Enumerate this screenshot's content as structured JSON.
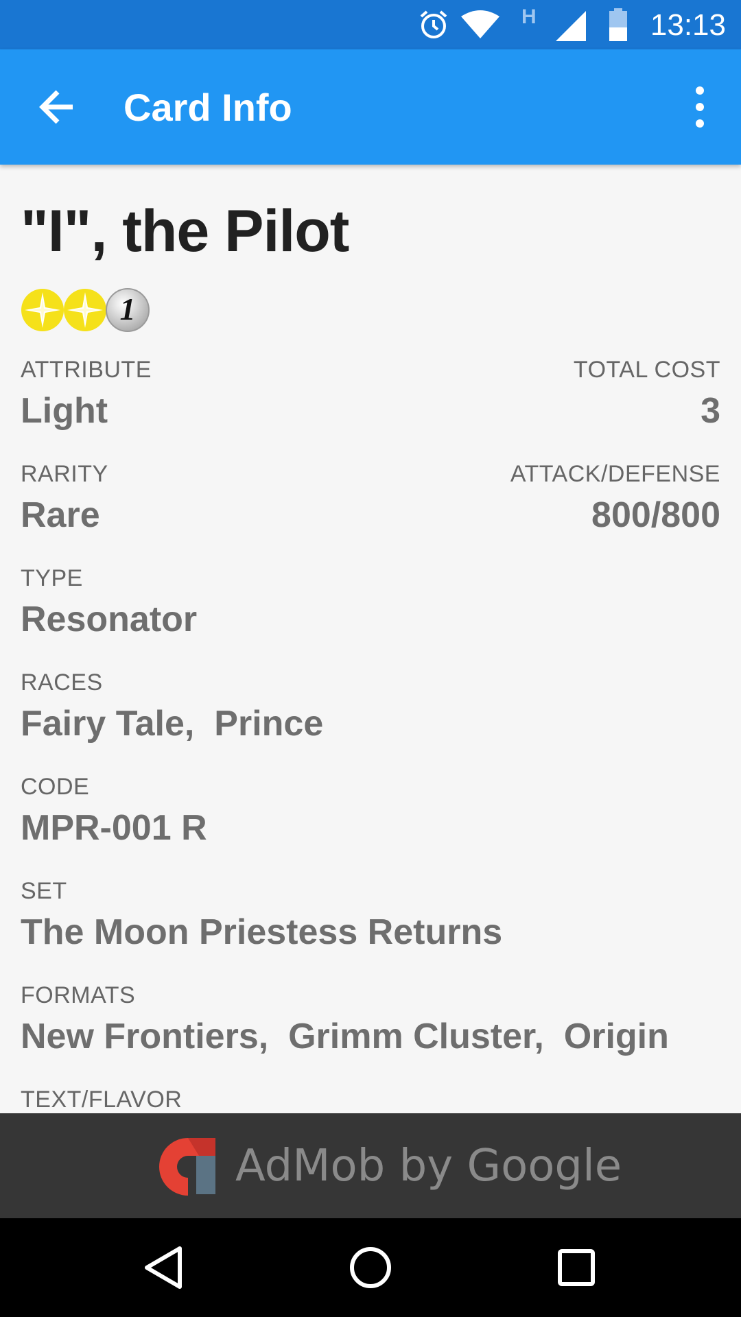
{
  "status": {
    "time": "13:13",
    "network_label": "H"
  },
  "appbar": {
    "title": "Card Info"
  },
  "card": {
    "name": "\"I\", the Pilot",
    "cost_number": "1",
    "attribute": {
      "label": "ATTRIBUTE",
      "value": "Light"
    },
    "total_cost": {
      "label": "TOTAL COST",
      "value": "3"
    },
    "rarity": {
      "label": "RARITY",
      "value": "Rare"
    },
    "attack_defense": {
      "label": "ATTACK/DEFENSE",
      "value": "800/800"
    },
    "type": {
      "label": "TYPE",
      "value": "Resonator"
    },
    "races": {
      "label": "RACES",
      "value": "Fairy Tale,  Prince"
    },
    "code": {
      "label": "CODE",
      "value": "MPR-001 R"
    },
    "set": {
      "label": "SET",
      "value": "The Moon Priestess Returns"
    },
    "formats": {
      "label": "FORMATS",
      "value": "New Frontiers,  Grimm Cluster,  Origin"
    },
    "text_flavor": {
      "label": "TEXT/FLAVOR"
    }
  },
  "ad": {
    "text": "AdMob by Google"
  },
  "colors": {
    "status_bar": "#1976d2",
    "app_bar": "#2196f3",
    "light_symbol": "#f5e11a",
    "ad_background": "#363636"
  },
  "icons": {
    "back": "arrow-left-icon",
    "more": "more-vert-icon",
    "alarm": "alarm-icon",
    "wifi": "wifi-icon",
    "signal": "cell-signal-icon",
    "battery": "battery-icon",
    "nav_back": "nav-back-icon",
    "nav_home": "nav-home-icon",
    "nav_recents": "nav-recents-icon"
  }
}
